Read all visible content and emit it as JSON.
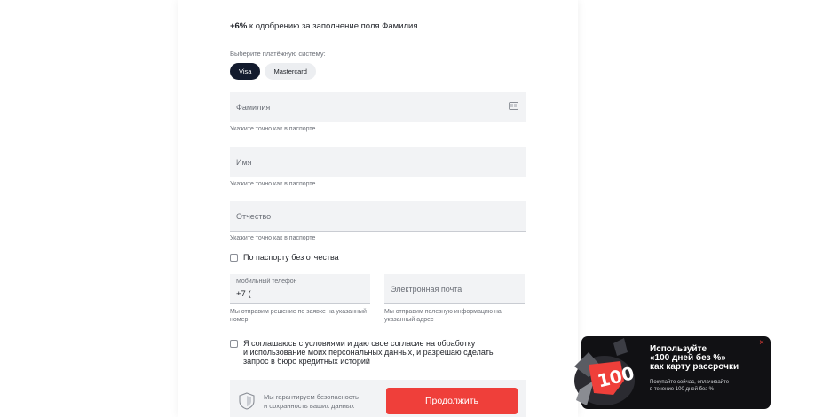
{
  "approval_hint": {
    "percent": "+6%",
    "text": " к одобрению за заполнение поля Фамилия"
  },
  "payment": {
    "label": "Выберите платёжную систему:",
    "options": [
      "Visa",
      "Mastercard"
    ],
    "selected": "Visa"
  },
  "fields": {
    "surname": {
      "placeholder": "Фамилия",
      "helper": "Укажите точно как в паспорте",
      "icon": "id-card-icon"
    },
    "name": {
      "placeholder": "Имя",
      "helper": "Укажите точно как в паспорте"
    },
    "patronymic": {
      "placeholder": "Отчество",
      "helper": "Укажите точно как в паспорте"
    },
    "no_patronymic": {
      "label": "По паспорту без отчества",
      "checked": false
    },
    "phone": {
      "label": "Мобильный телефон",
      "value": "+7 (",
      "helper": "Мы отправим решение по заявке на указанный номер"
    },
    "email": {
      "placeholder": "Электронная почта",
      "helper": "Мы отправим полезную информацию на указанный адрес"
    }
  },
  "consent": {
    "checked": false,
    "line1": "Я соглашаюсь с условиями и даю свое согласие на обработку",
    "line2": "и использование моих персональных данных, и разрешаю сделать",
    "line3": "запрос в бюро кредитных историй"
  },
  "footer": {
    "guarantee_line1": "Мы гарантируем безопасность",
    "guarantee_line2": "и сохранность ваших данных",
    "continue_label": "Продолжить"
  },
  "promo": {
    "title_line1": "Используйте",
    "title_line2": "«100 дней без %»",
    "title_line3": "как карту рассрочки",
    "sub_line1": "Покупайте сейчас, оплачивайте",
    "sub_line2": "в течение 100 дней без %",
    "art_text": "100",
    "close": "×"
  },
  "colors": {
    "accent": "#ef3f3a",
    "chip_active": "#131b2e",
    "promo_bg": "#111114"
  }
}
